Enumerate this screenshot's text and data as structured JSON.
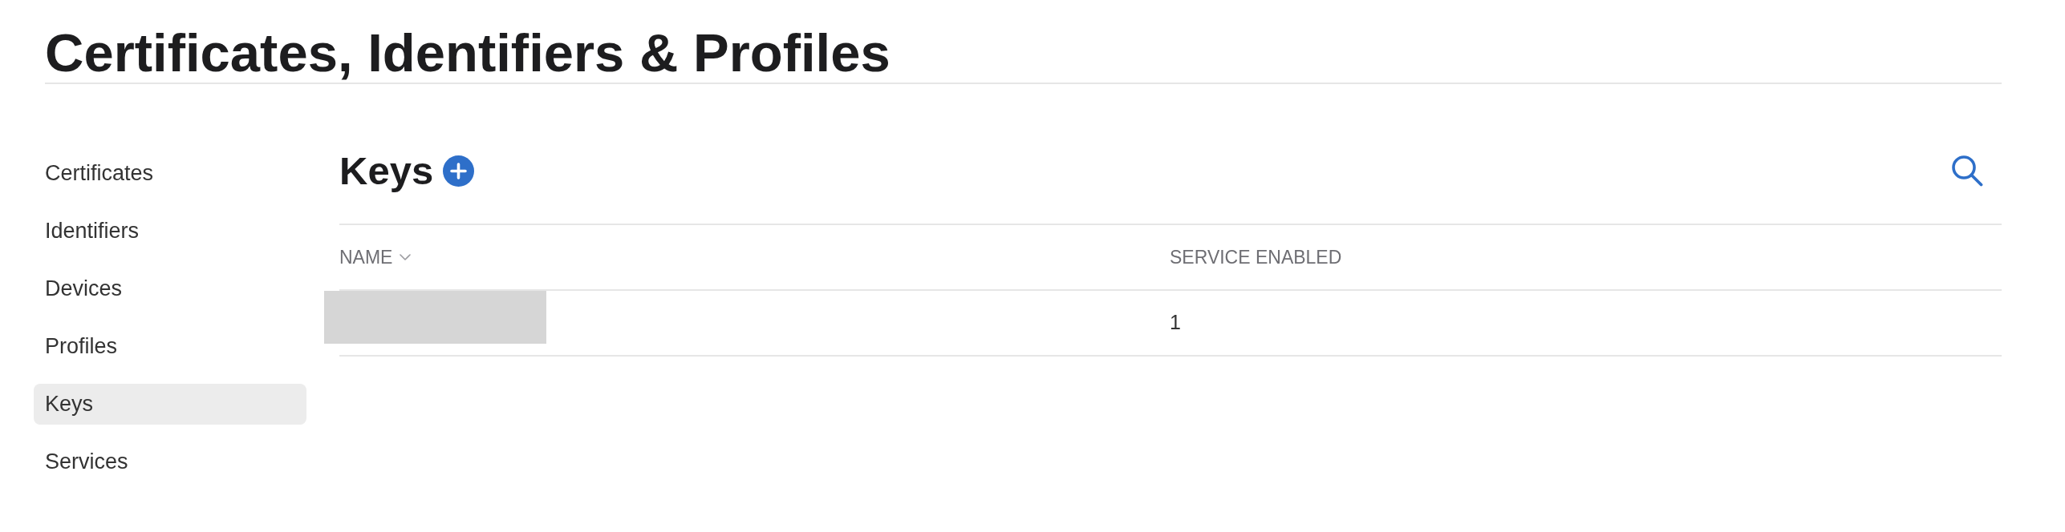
{
  "page": {
    "title": "Certificates, Identifiers & Profiles"
  },
  "sidebar": {
    "items": [
      {
        "label": "Certificates",
        "selected": false
      },
      {
        "label": "Identifiers",
        "selected": false
      },
      {
        "label": "Devices",
        "selected": false
      },
      {
        "label": "Profiles",
        "selected": false
      },
      {
        "label": "Keys",
        "selected": true
      },
      {
        "label": "Services",
        "selected": false
      }
    ]
  },
  "section": {
    "title": "Keys"
  },
  "table": {
    "columns": [
      {
        "label": "NAME",
        "sorted": true
      },
      {
        "label": "SERVICE ENABLED",
        "sorted": false
      }
    ],
    "rows": [
      {
        "name_redacted": true,
        "service_enabled": "1"
      }
    ]
  }
}
